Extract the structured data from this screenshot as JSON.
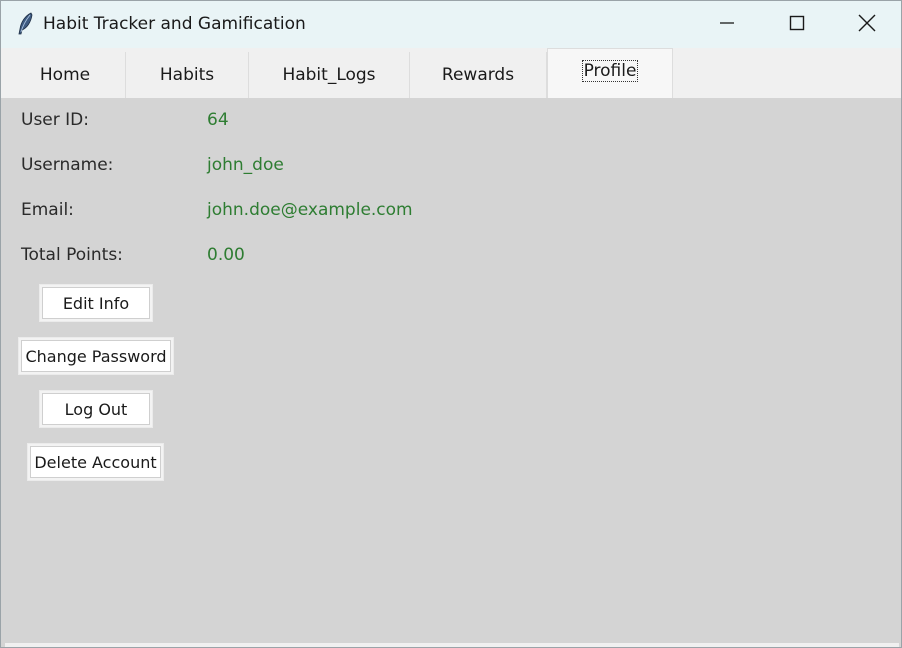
{
  "window": {
    "title": "Habit Tracker and Gamification",
    "icon": "feather-icon"
  },
  "titlebar_controls": {
    "minimize_icon": "minimize-icon",
    "maximize_icon": "maximize-icon",
    "close_icon": "close-icon"
  },
  "tabs": [
    {
      "label": "Home",
      "active": false
    },
    {
      "label": "Habits",
      "active": false
    },
    {
      "label": "Habit_Logs",
      "active": false
    },
    {
      "label": "Rewards",
      "active": false
    },
    {
      "label": "Profile",
      "active": true
    }
  ],
  "profile": {
    "user_id_label": "User ID:",
    "user_id_value": "64",
    "username_label": "Username:",
    "username_value": "john_doe",
    "email_label": "Email:",
    "email_value": "john.doe@example.com",
    "points_label": "Total Points:",
    "points_value": "0.00"
  },
  "buttons": {
    "edit_info": "Edit Info",
    "change_password": "Change Password",
    "log_out": "Log Out",
    "delete_account": "Delete Account"
  },
  "colors": {
    "value_text": "#2e7d32",
    "titlebar_bg": "#e9f4f6",
    "content_bg": "#d4d4d4",
    "tabbar_bg": "#f0f0f0"
  }
}
